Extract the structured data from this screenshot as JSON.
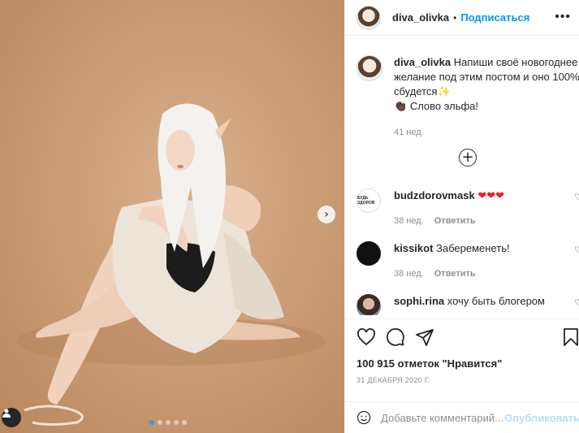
{
  "post": {
    "username": "diva_olivka",
    "follow_label": "Подписаться",
    "separator": "•",
    "more_label": "•••"
  },
  "caption": {
    "username": "diva_olivka",
    "text": "Напиши своё новогоднее желание под этим постом и оно 100% сбудется",
    "emoji1": "✨",
    "line2_emoji": "👏🏿",
    "line2": "Слово эльфа!",
    "age": "41 нед."
  },
  "comments": [
    {
      "username": "budzdorovmask",
      "text": "❤❤❤",
      "age": "38 нед.",
      "reply": "Ответить"
    },
    {
      "username": "kissikot",
      "text": "Забеременеть!",
      "age": "38 нед.",
      "reply": "Ответить"
    },
    {
      "username": "sophi.rina",
      "text": "хочу быть блогером"
    }
  ],
  "likes": "100 915 отметок \"Нравится\"",
  "date": "31 ДЕКАБРЯ 2020 Г.",
  "comment_box": {
    "placeholder": "Добавьте комментарий...",
    "publish": "Опубликовать"
  },
  "icons": {
    "next": "chevron-right-icon",
    "like": "heart-icon",
    "comment": "comment-icon",
    "share": "paper-plane-icon",
    "save": "bookmark-icon",
    "emoji": "smiley-icon",
    "load_more": "plus-circle-icon"
  },
  "carousel": {
    "count": 5,
    "active": 1
  },
  "colors": {
    "accent": "#0095f6",
    "heart": "#ed1c24",
    "muted": "#8e8e8e"
  }
}
